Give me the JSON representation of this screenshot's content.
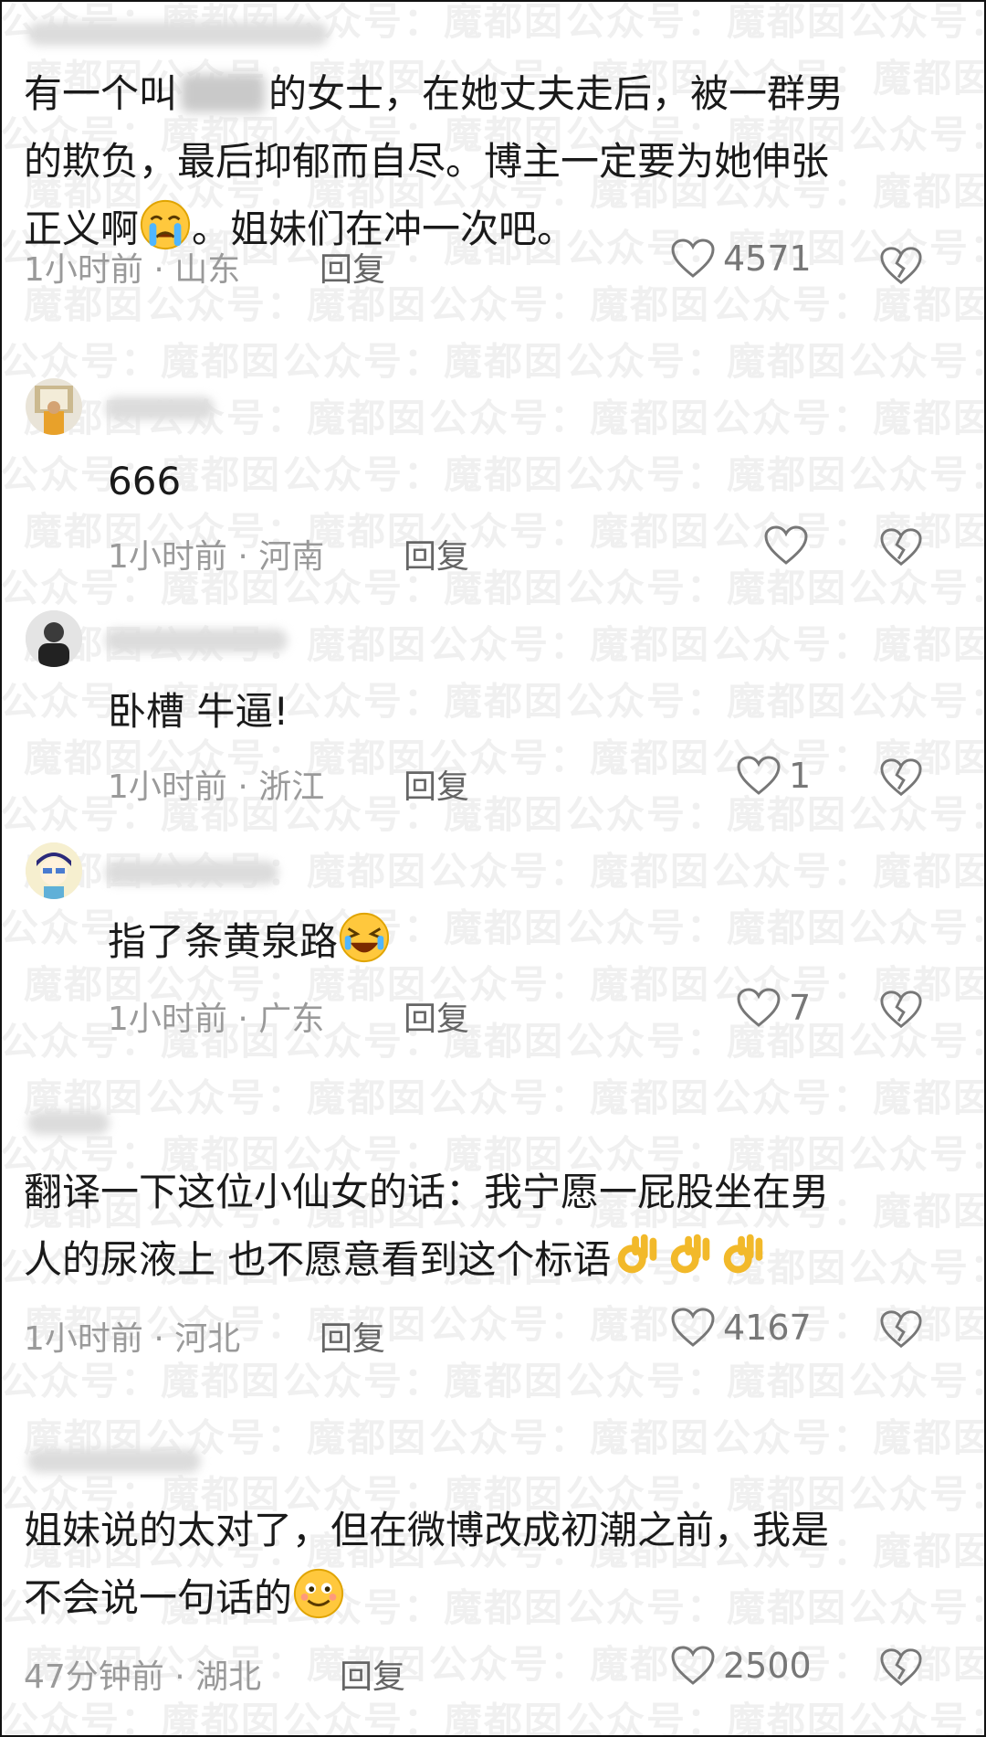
{
  "watermark": "公众号：魔都囡",
  "comments": [
    {
      "line1_pre": "有一个叫",
      "line1_post": "的女士，在她丈夫走后，被一群男",
      "line2": "的欺负，最后抑郁而自尽。博主一定要为她伸张",
      "line3_pre": "正义啊",
      "line3_post": "。姐妹们在冲一次吧。",
      "time": "1小时前",
      "location": "山东",
      "reply": "回复",
      "likes": "4571"
    },
    {
      "text": "666",
      "time": "1小时前",
      "location": "河南",
      "reply": "回复",
      "likes": ""
    },
    {
      "text": "卧槽 牛逼!",
      "time": "1小时前",
      "location": "浙江",
      "reply": "回复",
      "likes": "1"
    },
    {
      "text": "指了条黄泉路",
      "time": "1小时前",
      "location": "广东",
      "reply": "回复",
      "likes": "7"
    },
    {
      "line1": "翻译一下这位小仙女的话：我宁愿一屁股坐在男",
      "line2": "人的尿液上 也不愿意看到这个标语",
      "time": "1小时前",
      "location": "河北",
      "reply": "回复",
      "likes": "4167"
    },
    {
      "line1": "姐妹说的太对了，但在微博改成初潮之前，我是",
      "line2": "不会说一句话的",
      "time": "47分钟前",
      "location": "湖北",
      "reply": "回复",
      "likes": "2500"
    }
  ],
  "separator": "·",
  "icons": {
    "like": "heart-outline-icon",
    "dislike": "broken-heart-icon",
    "emoji_cry": "loudly-crying-face-icon",
    "emoji_laugh": "rolling-laughing-face-icon",
    "emoji_ok": "ok-hand-icon",
    "emoji_smile": "smiling-face-icon"
  }
}
